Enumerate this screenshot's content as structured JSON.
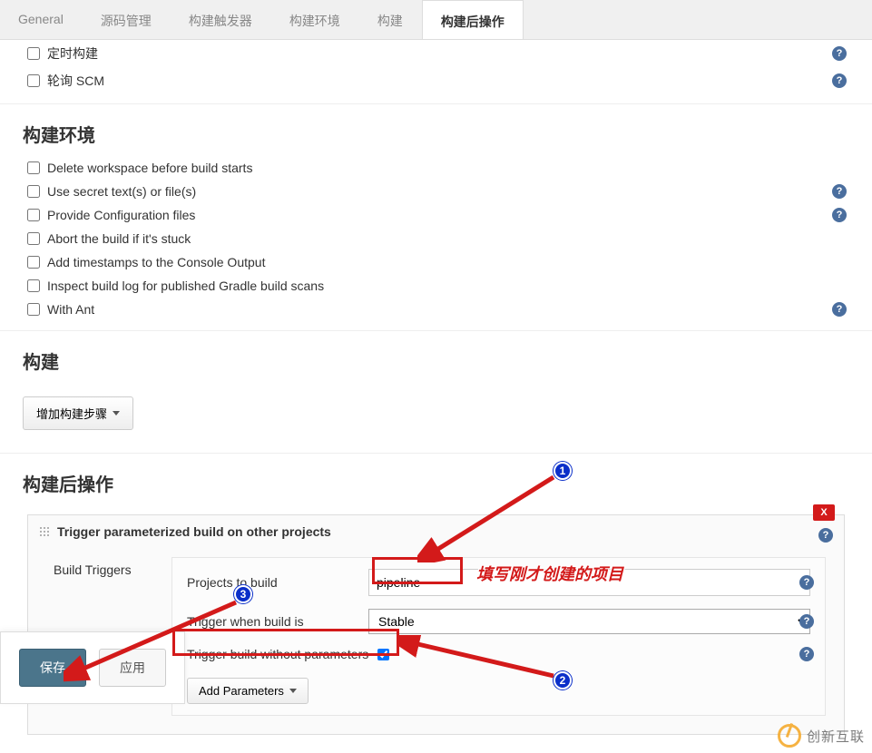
{
  "tabs": {
    "general": "General",
    "scm": "源码管理",
    "triggers": "构建触发器",
    "env": "构建环境",
    "build": "构建",
    "postbuild": "构建后操作"
  },
  "triggersSection": {
    "scheduled": "定时构建",
    "pollscm": "轮询 SCM"
  },
  "envSection": {
    "title": "构建环境",
    "deleteWs": "Delete workspace before build starts",
    "secret": "Use secret text(s) or file(s)",
    "configFiles": "Provide Configuration files",
    "abortStuck": "Abort the build if it's stuck",
    "timestamps": "Add timestamps to the Console Output",
    "gradleScan": "Inspect build log for published Gradle build scans",
    "withAnt": "With Ant"
  },
  "buildSection": {
    "title": "构建",
    "addStep": "增加构建步骤"
  },
  "postSection": {
    "title": "构建后操作",
    "closeX": "X",
    "triggerTitle": "Trigger parameterized build on other projects",
    "buildTriggers": "Build Triggers",
    "projectsToBuild": "Projects to build",
    "projectsValue": "pipeline",
    "triggerWhen": "Trigger when build is",
    "triggerWhenValue": "Stable",
    "withoutParams": "Trigger build without parameters",
    "addParams": "Add Parameters"
  },
  "footer": {
    "save": "保存",
    "apply": "应用"
  },
  "annotations": {
    "note1": "填写刚才创建的项目",
    "n1": "1",
    "n2": "2",
    "n3": "3"
  },
  "helpGlyph": "?",
  "watermark": {
    "text": "创新互联"
  }
}
